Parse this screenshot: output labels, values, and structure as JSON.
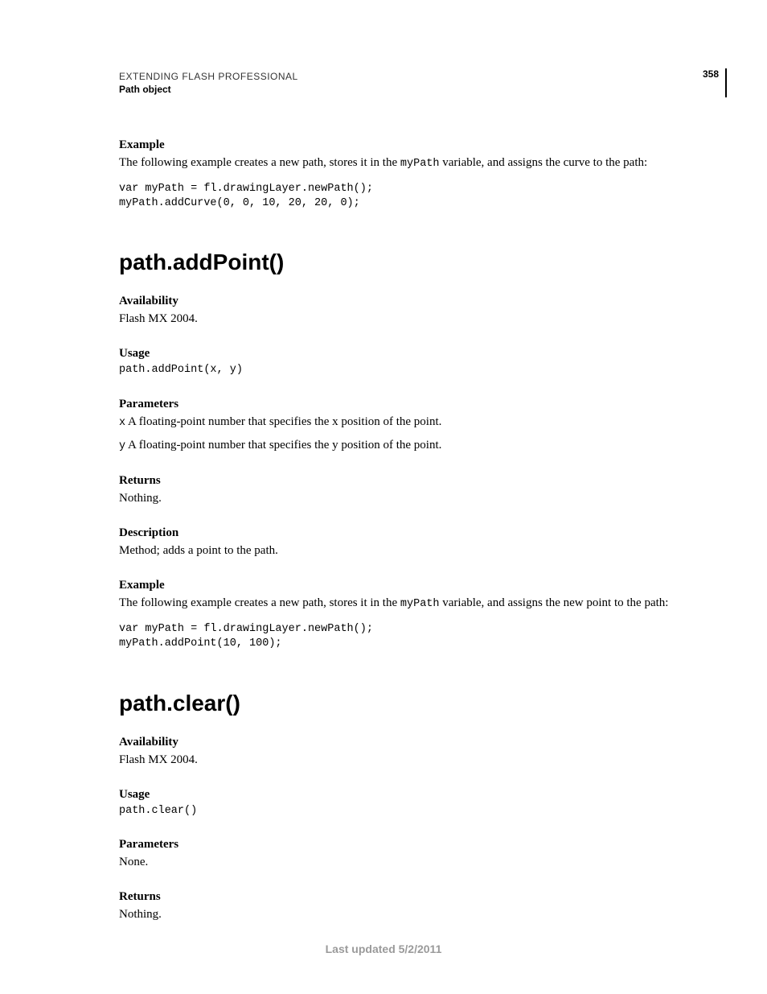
{
  "header": {
    "doc_title": "EXTENDING FLASH PROFESSIONAL",
    "section": "Path object",
    "page_number": "358"
  },
  "sec0": {
    "example_h": "Example",
    "example_text_a": "The following example creates a new path, stores it in the ",
    "example_var": "myPath",
    "example_text_b": " variable, and assigns the curve to the path:",
    "code": "var myPath = fl.drawingLayer.newPath();\nmyPath.addCurve(0, 0, 10, 20, 20, 0);"
  },
  "sec1": {
    "title": "path.addPoint()",
    "avail_h": "Availability",
    "avail_t": "Flash MX 2004.",
    "usage_h": "Usage",
    "usage_code": "path.addPoint(x, y)",
    "params_h": "Parameters",
    "param_x_name": "x",
    "param_x_text_a": "  A floating-point number that specifies the ",
    "param_x_italic": "x",
    "param_x_text_b": " position of the point.",
    "param_y_name": "y",
    "param_y_text_a": "  A floating-point number that specifies the ",
    "param_y_italic": "y",
    "param_y_text_b": " position of the point.",
    "returns_h": "Returns",
    "returns_t": "Nothing.",
    "desc_h": "Description",
    "desc_t": "Method; adds a point to the path.",
    "example_h": "Example",
    "example_text_a": "The following example creates a new path, stores it in the ",
    "example_var": "myPath",
    "example_text_b": " variable, and assigns the new point to the path:",
    "code": "var myPath = fl.drawingLayer.newPath();\nmyPath.addPoint(10, 100);"
  },
  "sec2": {
    "title": "path.clear()",
    "avail_h": "Availability",
    "avail_t": "Flash MX 2004.",
    "usage_h": "Usage",
    "usage_code": "path.clear()",
    "params_h": "Parameters",
    "params_t": "None.",
    "returns_h": "Returns",
    "returns_t": "Nothing."
  },
  "footer": "Last updated 5/2/2011"
}
